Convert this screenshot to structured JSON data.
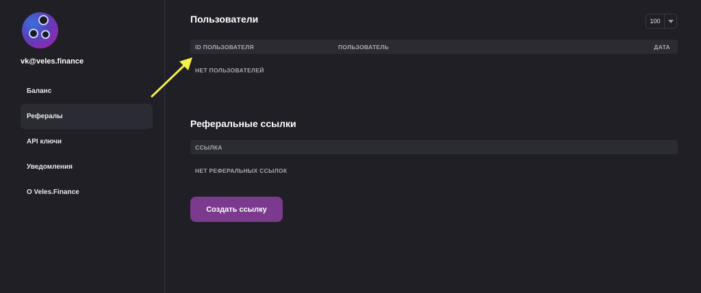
{
  "sidebar": {
    "email": "vk@veles.finance",
    "items": [
      {
        "label": "Баланс"
      },
      {
        "label": "Рефералы"
      },
      {
        "label": "API ключи"
      },
      {
        "label": "Уведомления"
      },
      {
        "label": "О Veles.Finance"
      }
    ],
    "active_item": "Рефералы"
  },
  "users_section": {
    "title": "Пользователи",
    "per_page": "100",
    "columns": [
      "ID ПОЛЬЗОВАТЕЛЯ",
      "ПОЛЬЗОВАТЕЛЬ",
      "ДАТА"
    ],
    "empty_text": "НЕТ ПОЛЬЗОВАТЕЛЕЙ"
  },
  "links_section": {
    "title": "Реферальные ссылки",
    "columns": [
      "ССЫЛКА"
    ],
    "empty_text": "НЕТ РЕФЕРАЛЬНЫХ ССЫЛОК",
    "create_button": "Создать ссылку"
  },
  "colors": {
    "background": "#1f1f25",
    "accent": "#7c3a8e",
    "annotation_arrow": "#f5f04a"
  }
}
